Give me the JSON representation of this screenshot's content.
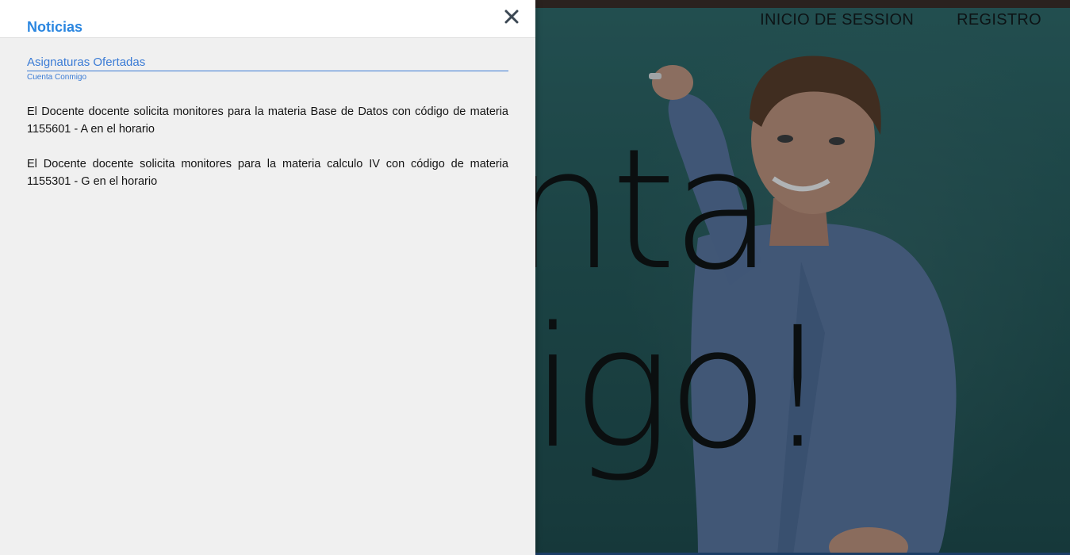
{
  "panel": {
    "title": "Noticias",
    "close_icon": "close-icon",
    "section": {
      "title": "Asignaturas Ofertadas",
      "subtitle": "Cuenta Conmigo",
      "items": [
        {
          "text": "El Docente docente solicita monitores para la materia Base de Datos con código de materia 1155601 - A en el horario"
        },
        {
          "text": "El Docente docente solicita monitores para la materia calculo IV con código de materia 1155301 - G en el horario"
        }
      ]
    }
  },
  "nav": {
    "login_label": "INICIO DE SESSION",
    "register_label": "REGISTRO"
  },
  "hero": {
    "slogan_line1": "enta",
    "slogan_line2": "migo!"
  },
  "colors": {
    "accent": "#2a86e0",
    "link": "#3a7bd5",
    "panel_bg": "#f0f0f0"
  }
}
